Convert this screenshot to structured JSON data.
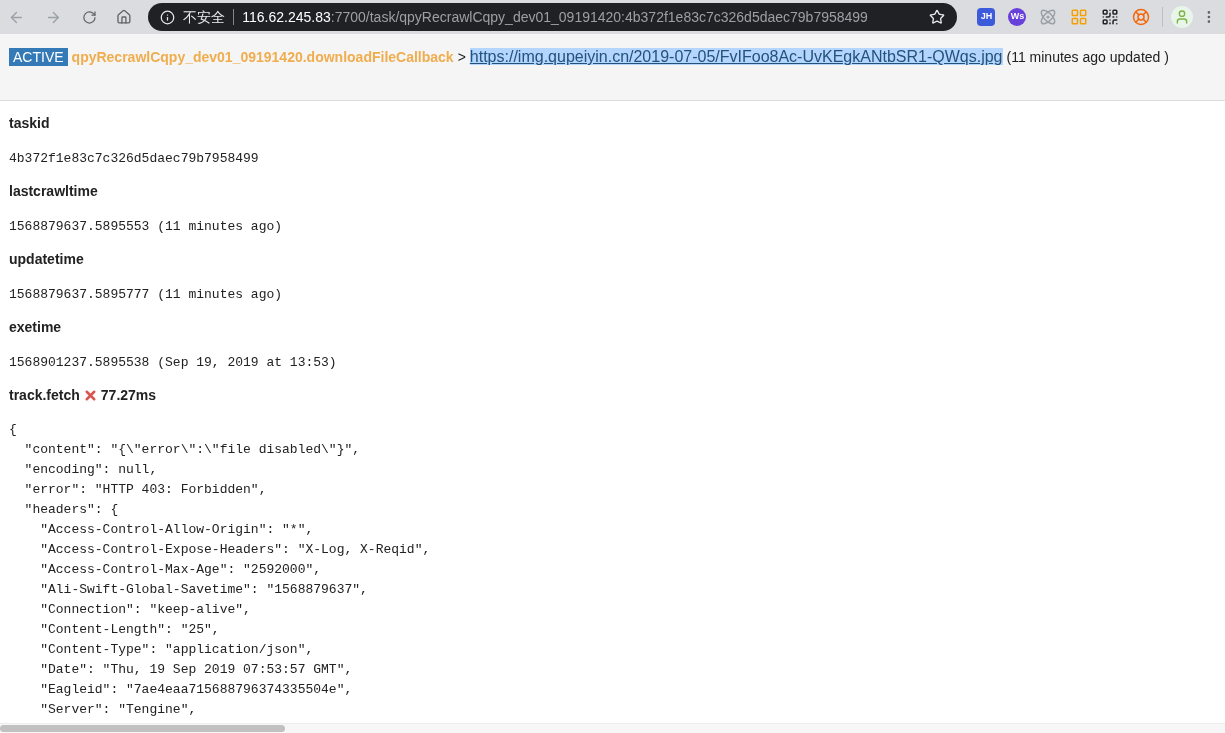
{
  "browser": {
    "security_label": "不安全",
    "url_host": "116.62.245.83",
    "url_path": ":7700/task/qpyRecrawlCqpy_dev01_09191420:4b372f1e83c7c326d5daec79b7958499",
    "extensions": [
      {
        "kind": "text",
        "label": "JH"
      },
      {
        "kind": "text",
        "label": "Ws"
      },
      {
        "kind": "atom"
      },
      {
        "kind": "grid"
      },
      {
        "kind": "qr"
      },
      {
        "kind": "ring"
      }
    ]
  },
  "header": {
    "status": "ACTIVE",
    "task_name": "qpyRecrawlCqpy_dev01_09191420.downloadFileCallback",
    "separator": ">",
    "url": "https://img.qupeiyin.cn/2019-07-05/FvIFoo8Ac-UvKEgkANtbSR1-QWqs.jpg",
    "url_selected": true,
    "updated": "(11 minutes ago updated )"
  },
  "fields": [
    {
      "label": "taskid",
      "value": "4b372f1e83c7c326d5daec79b7958499"
    },
    {
      "label": "lastcrawltime",
      "value": "1568879637.5895553 (11 minutes ago)"
    },
    {
      "label": "updatetime",
      "value": "1568879637.5895777 (11 minutes ago)"
    },
    {
      "label": "exetime",
      "value": "1568901237.5895538 (Sep 19, 2019 at 13:53)"
    }
  ],
  "track": {
    "label": "track.fetch",
    "ok": false,
    "time": "77.27ms",
    "output": "{\n  \"content\": \"{\\\"error\\\":\\\"file disabled\\\"}\",\n  \"encoding\": null,\n  \"error\": \"HTTP 403: Forbidden\",\n  \"headers\": {\n    \"Access-Control-Allow-Origin\": \"*\",\n    \"Access-Control-Expose-Headers\": \"X-Log, X-Reqid\",\n    \"Access-Control-Max-Age\": \"2592000\",\n    \"Ali-Swift-Global-Savetime\": \"1568879637\",\n    \"Connection\": \"keep-alive\",\n    \"Content-Length\": \"25\",\n    \"Content-Type\": \"application/json\",\n    \"Date\": \"Thu, 19 Sep 2019 07:53:57 GMT\",\n    \"Eagleid\": \"7ae4eaa715688796374335504e\",\n    \"Server\": \"Tengine\","
  }
}
